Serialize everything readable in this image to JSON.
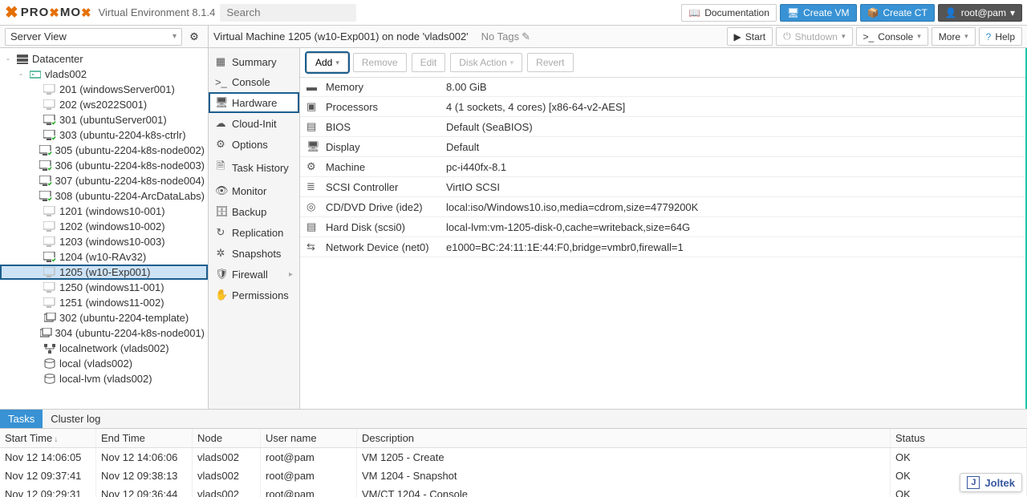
{
  "header": {
    "logo_left": "PRO",
    "logo_right": "MO",
    "env": "Virtual Environment 8.1.4",
    "search_placeholder": "Search",
    "doc": "Documentation",
    "create_vm": "Create VM",
    "create_ct": "Create CT",
    "user": "root@pam"
  },
  "subheader": {
    "server_view": "Server View",
    "breadcrumb": "Virtual Machine 1205 (w10-Exp001) on node 'vlads002'",
    "no_tags": "No Tags",
    "actions": {
      "start": "Start",
      "shutdown": "Shutdown",
      "console": "Console",
      "more": "More",
      "help": "Help"
    }
  },
  "tree": [
    {
      "lvl": 0,
      "icon": "datacenter",
      "label": "Datacenter",
      "expand": "-"
    },
    {
      "lvl": 1,
      "icon": "node",
      "label": "vlads002",
      "expand": "-"
    },
    {
      "lvl": 2,
      "icon": "vm-off",
      "label": "201 (windowsServer001)"
    },
    {
      "lvl": 2,
      "icon": "vm-off",
      "label": "202 (ws2022S001)"
    },
    {
      "lvl": 2,
      "icon": "vm-on",
      "label": "301 (ubuntuServer001)"
    },
    {
      "lvl": 2,
      "icon": "vm-on",
      "label": "303 (ubuntu-2204-k8s-ctrlr)"
    },
    {
      "lvl": 2,
      "icon": "vm-on",
      "label": "305 (ubuntu-2204-k8s-node002)"
    },
    {
      "lvl": 2,
      "icon": "vm-on",
      "label": "306 (ubuntu-2204-k8s-node003)"
    },
    {
      "lvl": 2,
      "icon": "vm-on",
      "label": "307 (ubuntu-2204-k8s-node004)"
    },
    {
      "lvl": 2,
      "icon": "vm-on",
      "label": "308 (ubuntu-2204-ArcDataLabs)"
    },
    {
      "lvl": 2,
      "icon": "vm-off",
      "label": "1201 (windows10-001)"
    },
    {
      "lvl": 2,
      "icon": "vm-off",
      "label": "1202 (windows10-002)"
    },
    {
      "lvl": 2,
      "icon": "vm-off",
      "label": "1203 (windows10-003)"
    },
    {
      "lvl": 2,
      "icon": "vm-on",
      "label": "1204 (w10-RAv32)"
    },
    {
      "lvl": 2,
      "icon": "vm-off",
      "label": "1205 (w10-Exp001)",
      "selected": true
    },
    {
      "lvl": 2,
      "icon": "vm-off",
      "label": "1250 (windows11-001)"
    },
    {
      "lvl": 2,
      "icon": "vm-off",
      "label": "1251 (windows11-002)"
    },
    {
      "lvl": 2,
      "icon": "template",
      "label": "302 (ubuntu-2204-template)"
    },
    {
      "lvl": 2,
      "icon": "template",
      "label": "304 (ubuntu-2204-k8s-node001)"
    },
    {
      "lvl": 2,
      "icon": "network",
      "label": "localnetwork (vlads002)"
    },
    {
      "lvl": 2,
      "icon": "storage",
      "label": "local (vlads002)"
    },
    {
      "lvl": 2,
      "icon": "storage",
      "label": "local-lvm (vlads002)"
    }
  ],
  "nav": [
    {
      "icon": "summary",
      "label": "Summary"
    },
    {
      "icon": "console",
      "label": "Console"
    },
    {
      "icon": "hardware",
      "label": "Hardware",
      "selected": true
    },
    {
      "icon": "cloud",
      "label": "Cloud-Init"
    },
    {
      "icon": "options",
      "label": "Options"
    },
    {
      "icon": "history",
      "label": "Task History"
    },
    {
      "icon": "monitor",
      "label": "Monitor"
    },
    {
      "icon": "backup",
      "label": "Backup"
    },
    {
      "icon": "repl",
      "label": "Replication"
    },
    {
      "icon": "snap",
      "label": "Snapshots"
    },
    {
      "icon": "firewall",
      "label": "Firewall",
      "submenu": true
    },
    {
      "icon": "perm",
      "label": "Permissions"
    }
  ],
  "hw_toolbar": {
    "add": "Add",
    "remove": "Remove",
    "edit": "Edit",
    "disk_action": "Disk Action",
    "revert": "Revert"
  },
  "hardware": [
    {
      "icon": "memory",
      "key": "Memory",
      "val": "8.00 GiB"
    },
    {
      "icon": "cpu",
      "key": "Processors",
      "val": "4 (1 sockets, 4 cores) [x86-64-v2-AES]"
    },
    {
      "icon": "bios",
      "key": "BIOS",
      "val": "Default (SeaBIOS)"
    },
    {
      "icon": "display",
      "key": "Display",
      "val": "Default"
    },
    {
      "icon": "machine",
      "key": "Machine",
      "val": "pc-i440fx-8.1"
    },
    {
      "icon": "scsi",
      "key": "SCSI Controller",
      "val": "VirtIO SCSI"
    },
    {
      "icon": "cd",
      "key": "CD/DVD Drive (ide2)",
      "val": "local:iso/Windows10.iso,media=cdrom,size=4779200K"
    },
    {
      "icon": "hdd",
      "key": "Hard Disk (scsi0)",
      "val": "local-lvm:vm-1205-disk-0,cache=writeback,size=64G"
    },
    {
      "icon": "net",
      "key": "Network Device (net0)",
      "val": "e1000=BC:24:11:1E:44:F0,bridge=vmbr0,firewall=1"
    }
  ],
  "log": {
    "tabs": {
      "tasks": "Tasks",
      "cluster": "Cluster log"
    },
    "headers": {
      "start": "Start Time",
      "end": "End Time",
      "node": "Node",
      "user": "User name",
      "desc": "Description",
      "status": "Status"
    },
    "rows": [
      {
        "start": "Nov 12 14:06:05",
        "end": "Nov 12 14:06:06",
        "node": "vlads002",
        "user": "root@pam",
        "desc": "VM 1205 - Create",
        "status": "OK"
      },
      {
        "start": "Nov 12 09:37:41",
        "end": "Nov 12 09:38:13",
        "node": "vlads002",
        "user": "root@pam",
        "desc": "VM 1204 - Snapshot",
        "status": "OK"
      },
      {
        "start": "Nov 12 09:29:31",
        "end": "Nov 12 09:36:44",
        "node": "vlads002",
        "user": "root@pam",
        "desc": "VM/CT 1204 - Console",
        "status": "OK"
      }
    ]
  },
  "brand": "Joltek"
}
